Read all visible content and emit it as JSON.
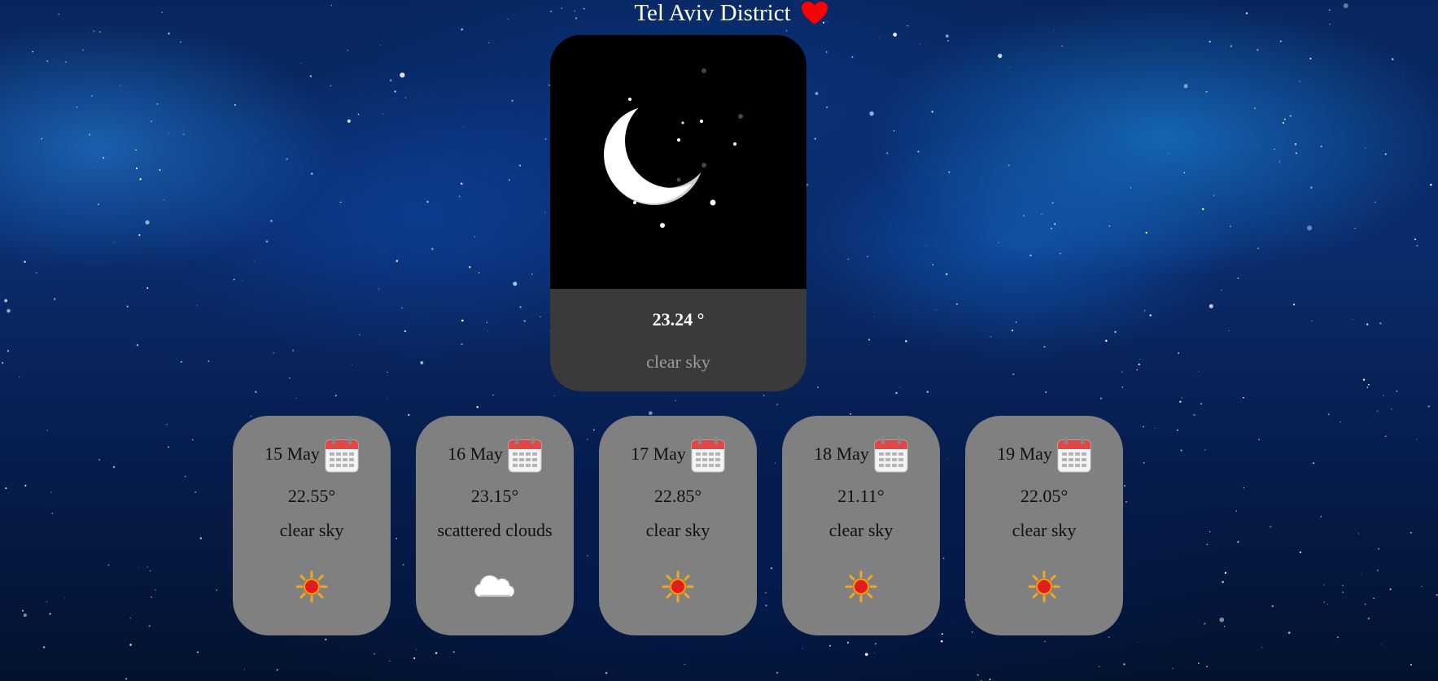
{
  "header": {
    "city": "Tel Aviv District",
    "favorite_icon": "heart-icon",
    "favorite_color": "#ff0000"
  },
  "current": {
    "image_icon": "crescent-moon-icon",
    "temperature": "23.24 °",
    "description": "clear sky"
  },
  "forecast": [
    {
      "date": "15 May",
      "date_icon": "calendar-icon",
      "temperature": "22.55°",
      "description": "clear sky",
      "icon": "sun-icon"
    },
    {
      "date": "16 May",
      "date_icon": "calendar-icon",
      "temperature": "23.15°",
      "description": "scattered clouds",
      "icon": "cloud-icon"
    },
    {
      "date": "17 May",
      "date_icon": "calendar-icon",
      "temperature": "22.85°",
      "description": "clear sky",
      "icon": "sun-icon"
    },
    {
      "date": "18 May",
      "date_icon": "calendar-icon",
      "temperature": "21.11°",
      "description": "clear sky",
      "icon": "sun-icon"
    },
    {
      "date": "19 May",
      "date_icon": "calendar-icon",
      "temperature": "22.05°",
      "description": "clear sky",
      "icon": "sun-icon"
    }
  ],
  "colors": {
    "card_grey": "#808080",
    "info_panel": "#3b3a3b",
    "background_blue": "#0a2c6e"
  }
}
